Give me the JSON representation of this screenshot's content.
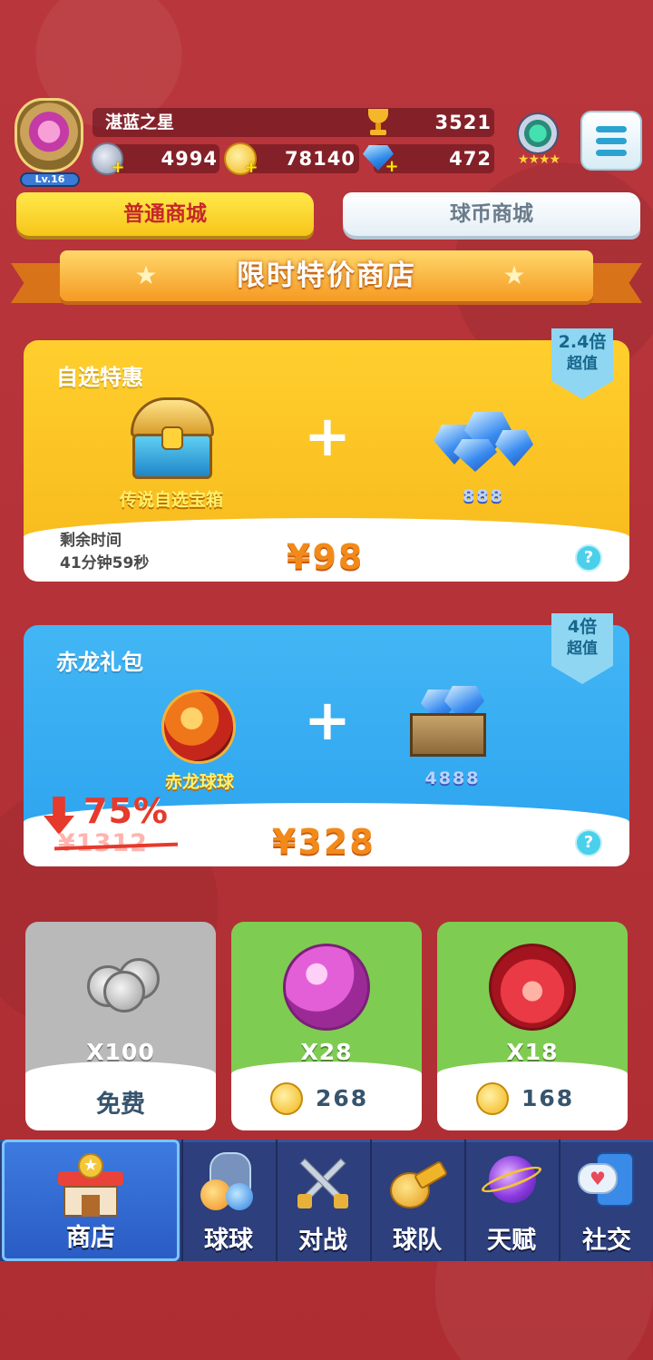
{
  "player": {
    "name": "湛蓝之星",
    "level": "Lv.16",
    "trophies": "3521"
  },
  "resources": {
    "silver": "4994",
    "gold": "78140",
    "diamonds": "472"
  },
  "tabs": [
    {
      "label": "普通商城",
      "active": true
    },
    {
      "label": "球币商城",
      "active": false
    }
  ],
  "banner": {
    "title": "限时特价商店"
  },
  "offers": [
    {
      "title": "自选特惠",
      "ribbon_line1": "2.4倍",
      "ribbon_line2": "超值",
      "item1_label": "传说自选宝箱",
      "item2_label": "888",
      "remaining_label": "剩余时间",
      "remaining_time": "41分钟59秒",
      "price": "¥98"
    },
    {
      "title": "赤龙礼包",
      "ribbon_line1": "4倍",
      "ribbon_line2": "超值",
      "item1_label": "赤龙球球",
      "item2_label": "4888",
      "discount": "75%",
      "original_price": "¥1312",
      "price": "¥328"
    }
  ],
  "items": [
    {
      "qty": "X100",
      "price": "免费",
      "currency": "none",
      "bg": "#b9b9b9"
    },
    {
      "qty": "X28",
      "price": "268",
      "currency": "gold",
      "bg": "#7fcc52"
    },
    {
      "qty": "X18",
      "price": "168",
      "currency": "gold",
      "bg": "#7fcc52"
    }
  ],
  "nav": [
    {
      "label": "商店",
      "icon": "shop-icon",
      "active": true
    },
    {
      "label": "球球",
      "icon": "balls-icon",
      "active": false
    },
    {
      "label": "对战",
      "icon": "battle-swords-icon",
      "active": false
    },
    {
      "label": "球队",
      "icon": "whistle-icon",
      "active": false
    },
    {
      "label": "天赋",
      "icon": "talent-planet-icon",
      "active": false
    },
    {
      "label": "社交",
      "icon": "social-chat-icon",
      "active": false
    }
  ],
  "colors": {
    "background": "#b53238",
    "tab_active": "#f7c51b",
    "price": "#f28a1a",
    "nav": "#2d3f7c"
  }
}
